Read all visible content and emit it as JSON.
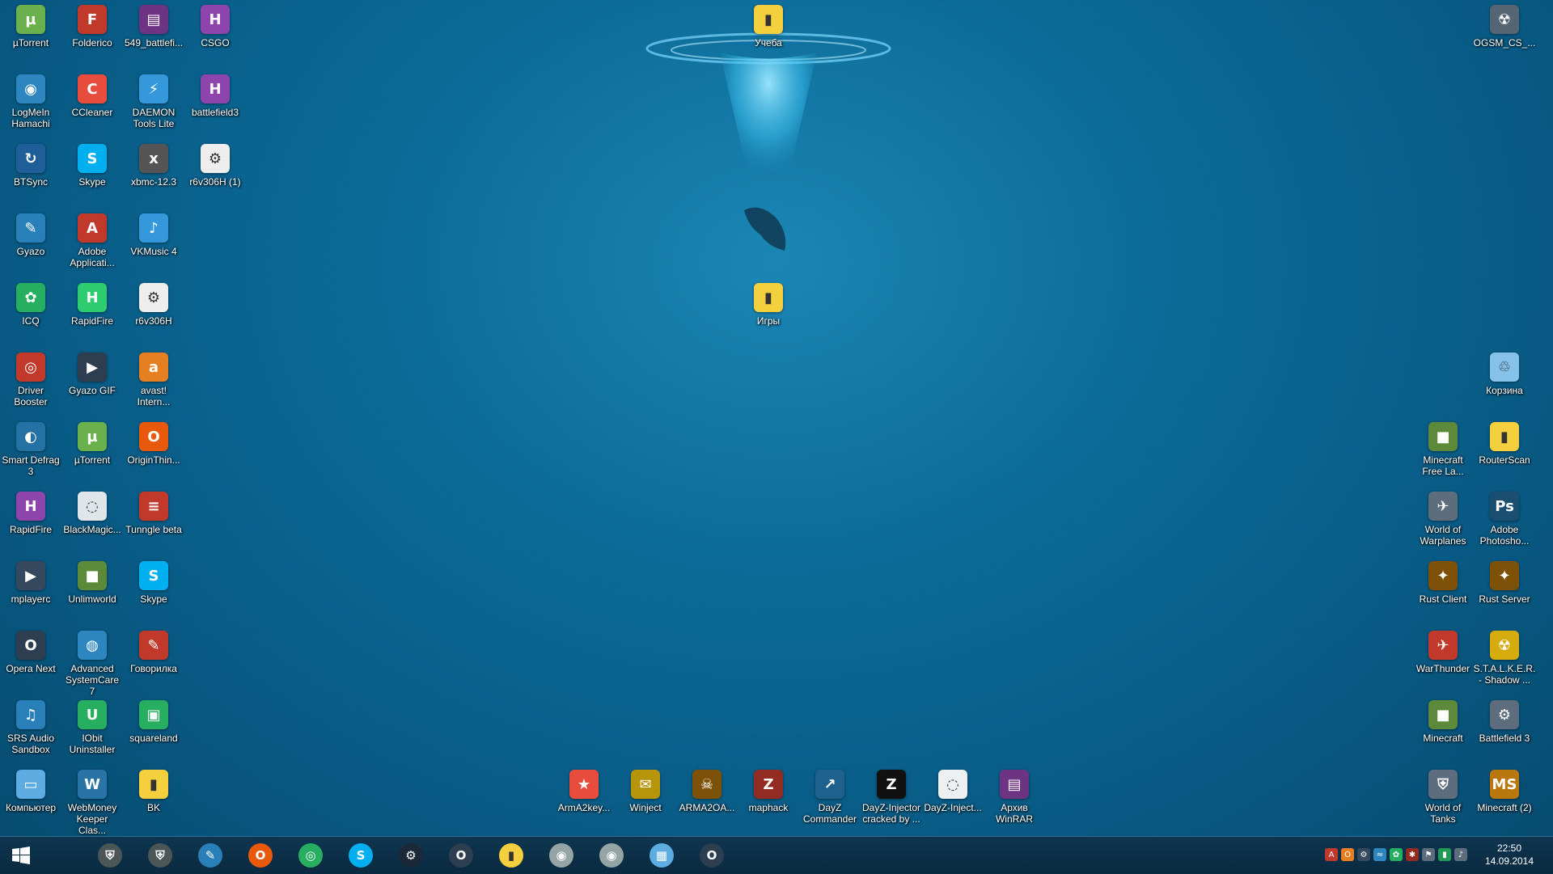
{
  "desktop": {
    "left_icons": [
      {
        "label": "µTorrent",
        "icon": "utorrent-icon",
        "glyph": "µ",
        "color": "#6ab04c"
      },
      {
        "label": "Folderico",
        "icon": "folderico-icon",
        "glyph": "F",
        "color": "#c0392b"
      },
      {
        "label": "549_battlefi...",
        "icon": "winrar-archive-icon",
        "glyph": "▤",
        "color": "#6c3483"
      },
      {
        "label": "CSGO",
        "icon": "document-h-icon",
        "glyph": "H",
        "color": "#8e44ad"
      },
      {
        "label": "LogMeIn Hamachi",
        "icon": "hamachi-icon",
        "glyph": "◉",
        "color": "#2e86c1"
      },
      {
        "label": "CCleaner",
        "icon": "ccleaner-icon",
        "glyph": "C",
        "color": "#e74c3c"
      },
      {
        "label": "DAEMON Tools Lite",
        "icon": "daemon-tools-icon",
        "glyph": "⚡",
        "color": "#3498db"
      },
      {
        "label": "battlefield3",
        "icon": "document-h-icon",
        "glyph": "H",
        "color": "#8e44ad"
      },
      {
        "label": "BTSync",
        "icon": "btsync-icon",
        "glyph": "↻",
        "color": "#1f5f99"
      },
      {
        "label": "Skype",
        "icon": "skype-icon",
        "glyph": "S",
        "color": "#00aff0"
      },
      {
        "label": "xbmc-12.3",
        "icon": "xbmc-icon",
        "glyph": "x",
        "color": "#555555"
      },
      {
        "label": "r6v306H (1)",
        "icon": "settings-file-icon",
        "glyph": "⚙",
        "color": "#eeeeee"
      },
      {
        "label": "Gyazo",
        "icon": "gyazo-icon",
        "glyph": "✎",
        "color": "#2980b9"
      },
      {
        "label": "Adobe Applicati...",
        "icon": "adobe-icon",
        "glyph": "A",
        "color": "#c0392b"
      },
      {
        "label": "VKMusic 4",
        "icon": "vkmusic-icon",
        "glyph": "♪",
        "color": "#3498db"
      },
      {
        "label": "ICQ",
        "icon": "icq-icon",
        "glyph": "✿",
        "color": "#27ae60"
      },
      {
        "label": "RapidFire",
        "icon": "rapidfire-icon",
        "glyph": "H",
        "color": "#2ecc71"
      },
      {
        "label": "r6v306H",
        "icon": "settings-file-icon",
        "glyph": "⚙",
        "color": "#eeeeee"
      },
      {
        "label": "Driver Booster",
        "icon": "driver-booster-icon",
        "glyph": "◎",
        "color": "#c0392b"
      },
      {
        "label": "Gyazo GIF",
        "icon": "gyazo-gif-icon",
        "glyph": "▶",
        "color": "#2c3e50"
      },
      {
        "label": "avast! Intern...",
        "icon": "avast-icon",
        "glyph": "a",
        "color": "#e67e22"
      },
      {
        "label": "Smart Defrag 3",
        "icon": "smart-defrag-icon",
        "glyph": "◐",
        "color": "#2471a3"
      },
      {
        "label": "µTorrent",
        "icon": "utorrent-icon",
        "glyph": "µ",
        "color": "#6ab04c"
      },
      {
        "label": "OriginThin...",
        "icon": "origin-icon",
        "glyph": "O",
        "color": "#e8590c"
      },
      {
        "label": "RapidFire",
        "icon": "document-h-icon",
        "glyph": "H",
        "color": "#8e44ad"
      },
      {
        "label": "BlackMagic...",
        "icon": "blackmagic-icon",
        "glyph": "◌",
        "color": "#dfe6e9"
      },
      {
        "label": "Tunngle beta",
        "icon": "tunngle-icon",
        "glyph": "≡",
        "color": "#c0392b"
      },
      {
        "label": "mplayerc",
        "icon": "mplayer-icon",
        "glyph": "▶",
        "color": "#34495e"
      },
      {
        "label": "Unlimworld",
        "icon": "minecraft-block-icon",
        "glyph": "■",
        "color": "#5d8a3a"
      },
      {
        "label": "Skype",
        "icon": "skype-icon",
        "glyph": "S",
        "color": "#00aff0"
      },
      {
        "label": "Opera Next",
        "icon": "opera-icon",
        "glyph": "O",
        "color": "#2c3e50"
      },
      {
        "label": "Advanced SystemCare 7",
        "icon": "systemcare-icon",
        "glyph": "◍",
        "color": "#2e86c1"
      },
      {
        "label": "Говорилка",
        "icon": "govorilka-icon",
        "glyph": "✎",
        "color": "#c0392b"
      },
      {
        "label": "SRS Audio Sandbox",
        "icon": "srs-audio-icon",
        "glyph": "♫",
        "color": "#2980b9"
      },
      {
        "label": "IObit Uninstaller",
        "icon": "iobit-uninstaller-icon",
        "glyph": "U",
        "color": "#27ae60"
      },
      {
        "label": "squareland",
        "icon": "creeper-icon",
        "glyph": "▣",
        "color": "#27ae60"
      },
      {
        "label": "Компьютер",
        "icon": "computer-icon",
        "glyph": "▭",
        "color": "#5dade2"
      },
      {
        "label": "WebMoney Keeper Clas...",
        "icon": "webmoney-icon",
        "glyph": "W",
        "color": "#2874a6"
      },
      {
        "label": "BK",
        "icon": "folder-icon",
        "glyph": "▮",
        "color": "#f4d03f"
      }
    ],
    "center_icons": [
      {
        "label": "Учеба",
        "icon": "folder-icon",
        "glyph": "▮",
        "color": "#f4d03f"
      },
      {
        "label": "Игры",
        "icon": "folder-icon",
        "glyph": "▮",
        "color": "#f4d03f"
      }
    ],
    "bottom_icons": [
      {
        "label": "ArmA2key...",
        "icon": "arma-star-icon",
        "glyph": "★",
        "color": "#e74c3c"
      },
      {
        "label": "Winject",
        "icon": "winject-icon",
        "glyph": "✉",
        "color": "#b7950b"
      },
      {
        "label": "ARMA2OA...",
        "icon": "arma2oa-icon",
        "glyph": "☠",
        "color": "#7e5109"
      },
      {
        "label": "maphack",
        "icon": "maphack-icon",
        "glyph": "Z",
        "color": "#922b21"
      },
      {
        "label": "DayZ Commander",
        "icon": "dayz-commander-icon",
        "glyph": "↗",
        "color": "#1f618d"
      },
      {
        "label": "DayZ-Injector cracked by ...",
        "icon": "dayz-injector-icon",
        "glyph": "Z",
        "color": "#111111"
      },
      {
        "label": "DayZ-Inject...",
        "icon": "document-icon",
        "glyph": "◌",
        "color": "#ecf0f1"
      },
      {
        "label": "Архив WinRAR",
        "icon": "winrar-icon",
        "glyph": "▤",
        "color": "#6c3483"
      }
    ],
    "right_icons": [
      {
        "label": "OGSM_CS_...",
        "icon": "radiation-icon",
        "glyph": "☢",
        "color": "#566573"
      },
      {
        "label": "Корзина",
        "icon": "recycle-bin-icon",
        "glyph": "♲",
        "color": "#85c1e9"
      },
      {
        "label": "Minecraft Free La...",
        "icon": "minecraft-block-icon",
        "glyph": "■",
        "color": "#5d8a3a"
      },
      {
        "label": "RouterScan",
        "icon": "folder-icon",
        "glyph": "▮",
        "color": "#f4d03f"
      },
      {
        "label": "World of Warplanes",
        "icon": "warplanes-icon",
        "glyph": "✈",
        "color": "#5d6d7e"
      },
      {
        "label": "Adobe Photosho...",
        "icon": "photoshop-icon",
        "glyph": "Ps",
        "color": "#1b4f72"
      },
      {
        "label": "Rust Client",
        "icon": "rust-icon",
        "glyph": "✦",
        "color": "#7e5109"
      },
      {
        "label": "Rust Server",
        "icon": "rust-icon",
        "glyph": "✦",
        "color": "#7e5109"
      },
      {
        "label": "WarThunder",
        "icon": "warthunder-icon",
        "glyph": "✈",
        "color": "#c0392b"
      },
      {
        "label": "S.T.A.L.K.E.R. - Shadow ...",
        "icon": "stalker-icon",
        "glyph": "☢",
        "color": "#d4ac0d"
      },
      {
        "label": "Minecraft",
        "icon": "minecraft-block-icon",
        "glyph": "■",
        "color": "#5d8a3a"
      },
      {
        "label": "Battlefield 3",
        "icon": "battlefield-icon",
        "glyph": "⚙",
        "color": "#5d6d7e"
      },
      {
        "label": "World of Tanks",
        "icon": "world-of-tanks-icon",
        "glyph": "⛨",
        "color": "#5d6d7e"
      },
      {
        "label": "Minecraft (2)",
        "icon": "ms-folder-icon",
        "glyph": "MS",
        "color": "#b9770e"
      }
    ]
  },
  "taskbar": {
    "start_icon": "windows-icon",
    "pinned": [
      {
        "icon": "world-of-tanks-icon",
        "glyph": "⛨",
        "color": "#4d5656"
      },
      {
        "icon": "world-of-tanks-icon",
        "glyph": "⛨",
        "color": "#4d5656"
      },
      {
        "icon": "gyazo-icon",
        "glyph": "✎",
        "color": "#2980b9"
      },
      {
        "icon": "origin-icon",
        "glyph": "O",
        "color": "#e8590c"
      },
      {
        "icon": "chrome-icon",
        "glyph": "◎",
        "color": "#27ae60"
      },
      {
        "icon": "skype-icon",
        "glyph": "S",
        "color": "#00aff0"
      },
      {
        "icon": "steam-icon",
        "glyph": "⚙",
        "color": "#1b2838"
      },
      {
        "icon": "opera-icon",
        "glyph": "O",
        "color": "#2c3e50"
      },
      {
        "icon": "file-explorer-icon",
        "glyph": "▮",
        "color": "#f4d03f"
      },
      {
        "icon": "speaker-icon",
        "glyph": "◉",
        "color": "#95a5a6"
      },
      {
        "icon": "speaker-icon",
        "glyph": "◉",
        "color": "#95a5a6"
      },
      {
        "icon": "calculator-icon",
        "glyph": "▦",
        "color": "#5dade2"
      },
      {
        "icon": "opera-icon",
        "glyph": "O",
        "color": "#2c3e50"
      }
    ],
    "tray": [
      {
        "icon": "adobe-tray-icon",
        "glyph": "A",
        "color": "#c0392b"
      },
      {
        "icon": "origin-tray-icon",
        "glyph": "O",
        "color": "#e67e22"
      },
      {
        "icon": "steam-tray-icon",
        "glyph": "⚙",
        "color": "#34495e"
      },
      {
        "icon": "network-tray-icon",
        "glyph": "≈",
        "color": "#2e86c1"
      },
      {
        "icon": "chat-tray-icon",
        "glyph": "✿",
        "color": "#27ae60"
      },
      {
        "icon": "shield-tray-icon",
        "glyph": "✱",
        "color": "#922b21"
      },
      {
        "icon": "action-center-icon",
        "glyph": "⚑",
        "color": "#5d6d7e"
      },
      {
        "icon": "battery-icon",
        "glyph": "▮",
        "color": "#229954"
      },
      {
        "icon": "volume-icon",
        "glyph": "♪",
        "color": "#5d6d7e"
      }
    ],
    "clock_time": "22:50",
    "clock_date": "14.09.2014"
  }
}
